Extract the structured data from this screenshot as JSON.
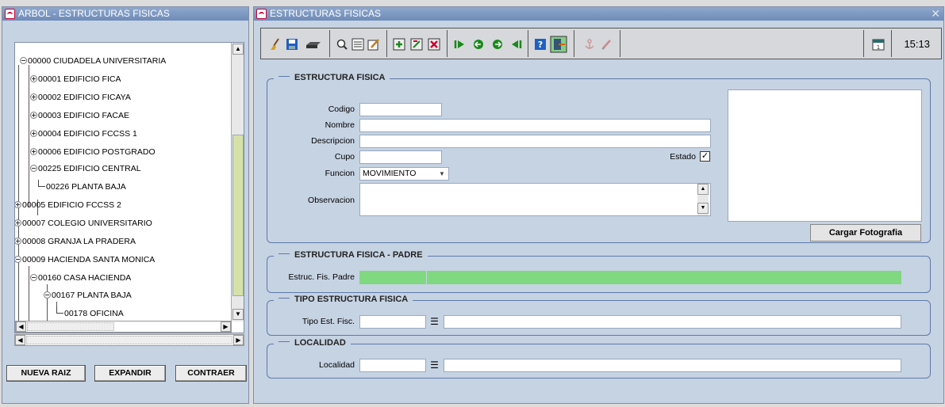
{
  "tree_window": {
    "title": "ARBOL - ESTRUCTURAS FISICAS",
    "nodes": [
      {
        "label": "00000 CIUDADELA UNIVERSITARIA",
        "state": "expanded"
      },
      {
        "label": "00001 EDIFICIO FICA",
        "state": "collapsed"
      },
      {
        "label": "00002 EDIFICIO FICAYA",
        "state": "collapsed"
      },
      {
        "label": "00003 EDIFICIO FACAE",
        "state": "collapsed"
      },
      {
        "label": "00004 EDIFICIO FCCSS 1",
        "state": "collapsed"
      },
      {
        "label": "00006 EDIFICIO POSTGRADO",
        "state": "collapsed"
      },
      {
        "label": "00225 EDIFICIO CENTRAL",
        "state": "expanded"
      },
      {
        "label": "00226 PLANTA BAJA",
        "state": "leaf"
      },
      {
        "label": "00005 EDIFICIO FCCSS 2",
        "state": "collapsed"
      },
      {
        "label": "00007 COLEGIO UNIVERSITARIO",
        "state": "collapsed"
      },
      {
        "label": "00008 GRANJA LA PRADERA",
        "state": "collapsed"
      },
      {
        "label": "00009 HACIENDA SANTA MONICA",
        "state": "expanded"
      },
      {
        "label": "00160 CASA HACIENDA",
        "state": "expanded"
      },
      {
        "label": "00167 PLANTA BAJA",
        "state": "expanded"
      },
      {
        "label": "00178 OFICINA",
        "state": "leaf"
      }
    ],
    "buttons": {
      "new_root": "NUEVA RAIZ",
      "expand": "EXPANDIR",
      "collapse": "CONTRAER"
    }
  },
  "form_window": {
    "title": "ESTRUCTURAS FISICAS",
    "close_symbol": "✕",
    "clock": "15:13",
    "toolbar_icons": [
      "clear-icon",
      "save-icon",
      "print-icon",
      "search-icon",
      "list-icon",
      "edit-icon",
      "insert-record-icon",
      "duplicate-record-icon",
      "delete-record-icon",
      "first-record-icon",
      "previous-record-icon",
      "next-record-icon",
      "last-record-icon",
      "help-icon",
      "exit-icon",
      "anchor-icon",
      "pen-icon",
      "calendar-icon"
    ],
    "sections": {
      "estructura": {
        "legend": "ESTRUCTURA FISICA",
        "codigo_label": "Codigo",
        "codigo_value": "",
        "nombre_label": "Nombre",
        "nombre_value": "",
        "descripcion_label": "Descripcion",
        "descripcion_value": "",
        "cupo_label": "Cupo",
        "cupo_value": "",
        "estado_label": "Estado",
        "estado_checked": true,
        "funcion_label": "Funcion",
        "funcion_value": "MOVIMIENTO",
        "observacion_label": "Observacion",
        "observacion_value": "",
        "photo_button": "Cargar Fotografia"
      },
      "padre": {
        "legend": "ESTRUCTURA FISICA - PADRE",
        "label": "Estruc. Fis. Padre",
        "code_value": "",
        "name_value": ""
      },
      "tipo": {
        "legend": "TIPO ESTRUCTURA FISICA",
        "label": "Tipo Est. Fisc.",
        "code_value": "",
        "name_value": ""
      },
      "localidad": {
        "legend": "LOCALIDAD",
        "label": "Localidad",
        "code_value": "",
        "name_value": ""
      }
    }
  }
}
